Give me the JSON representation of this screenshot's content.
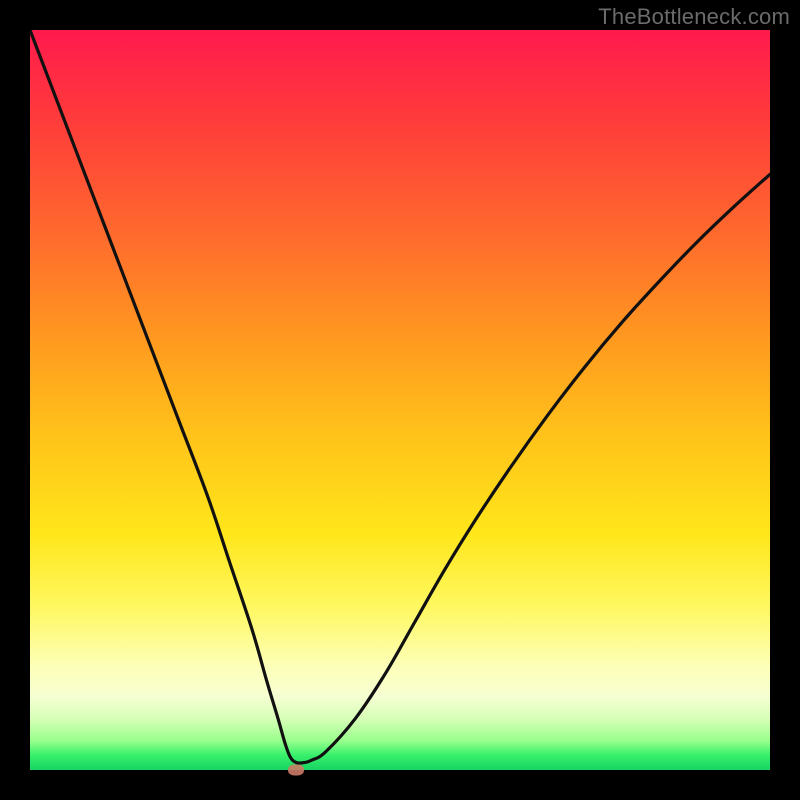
{
  "watermark": "TheBottleneck.com",
  "colors": {
    "curve_stroke": "#111111",
    "marker": "#cc7a66",
    "background": "#000000"
  },
  "chart_data": {
    "type": "line",
    "title": "",
    "xlabel": "",
    "ylabel": "",
    "xlim": [
      0,
      100
    ],
    "ylim": [
      0,
      100
    ],
    "x": [
      0,
      4,
      8,
      12,
      16,
      20,
      24,
      27,
      30,
      32,
      33.5,
      34.5,
      35.2,
      36,
      37,
      38,
      40,
      44,
      48,
      52,
      56,
      60,
      65,
      70,
      75,
      80,
      85,
      90,
      95,
      100
    ],
    "values": [
      100,
      89.5,
      79,
      68.5,
      58,
      47.5,
      37,
      28,
      19,
      12,
      7,
      3.5,
      1.7,
      1,
      1,
      1.3,
      2.5,
      7,
      13,
      20,
      27,
      33.5,
      41,
      48,
      54.5,
      60.5,
      66,
      71.2,
      76,
      80.5
    ],
    "marker": {
      "x": 36,
      "y": 0
    }
  }
}
